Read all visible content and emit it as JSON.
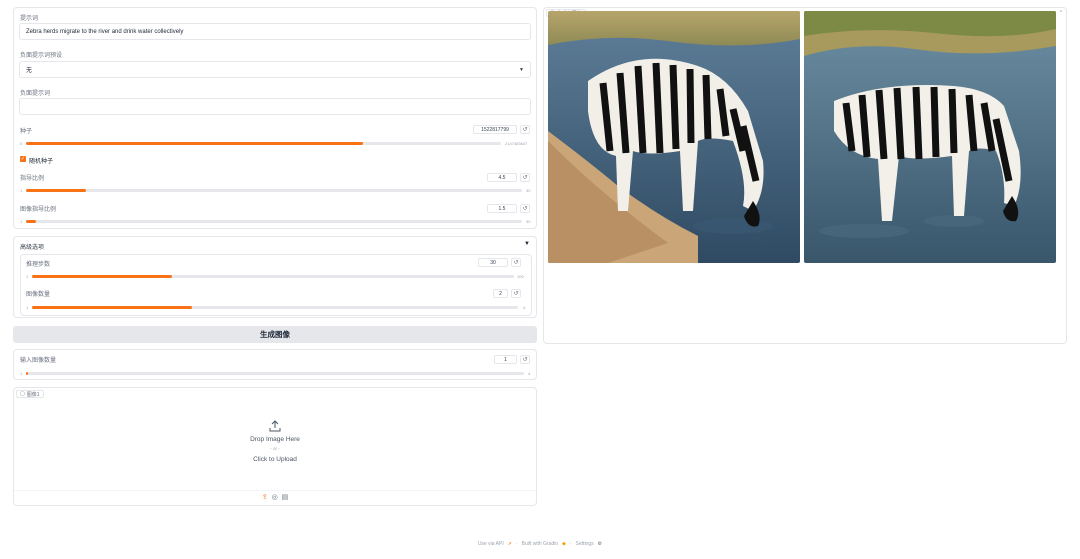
{
  "prompt": {
    "label": "提示词",
    "value": "Zebra herds migrate to the river and drink water collectively"
  },
  "negative_preset": {
    "label": "负面提示词预设",
    "value": "无"
  },
  "negative_prompt": {
    "label": "负面提示词",
    "value": ""
  },
  "seed": {
    "label": "种子",
    "value": "1522817799",
    "min": "0",
    "max": "2147483647",
    "fraction": 0.71
  },
  "random_seed": {
    "label": "随机种子",
    "checked": true
  },
  "guidance": {
    "label": "指导比例",
    "value": "4.5",
    "min": "1",
    "max": "30",
    "fraction": 0.12
  },
  "image_guidance": {
    "label": "图像指导比例",
    "value": "1.5",
    "min": "1",
    "max": "30",
    "fraction": 0.02
  },
  "advanced": {
    "label": "高级选项",
    "steps": {
      "label": "推理步数",
      "value": "30",
      "min": "1",
      "max": "100",
      "fraction": 0.29
    },
    "num_images": {
      "label": "图像数量",
      "value": "2",
      "min": "1",
      "max": "4",
      "fraction": 0.33
    }
  },
  "generate_button": "生成图像",
  "input_count": {
    "label": "输入图像数量",
    "value": "1",
    "min": "1",
    "max": "4",
    "fraction": 0.0
  },
  "upload": {
    "tag": "图像1",
    "drop_text": "Drop Image Here",
    "or_text": "- or -",
    "click_text": "Click to Upload"
  },
  "gallery": {
    "tag": "生成的图像"
  },
  "footer": {
    "api": "Use via API",
    "sep": "·",
    "built": "Built with Gradio",
    "settings": "Settings"
  },
  "colors": {
    "accent": "#f97316",
    "border": "#e5e7eb"
  },
  "icons": [
    "chevron-down-icon",
    "reset-icon",
    "check-icon",
    "upload-icon",
    "webcam-icon",
    "clipboard-icon",
    "image-icon",
    "rocket-icon",
    "gear-icon",
    "triangle-down-icon"
  ]
}
